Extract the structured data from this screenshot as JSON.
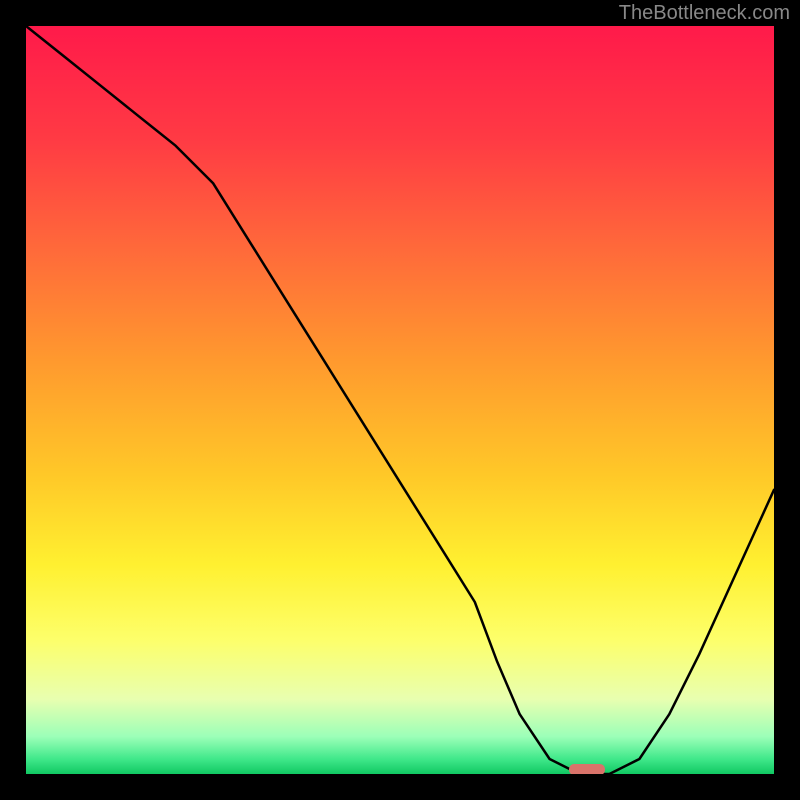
{
  "watermark": "TheBottleneck.com",
  "chart_data": {
    "type": "line",
    "title": "",
    "xlabel": "",
    "ylabel": "",
    "xlim": [
      0,
      100
    ],
    "ylim": [
      0,
      100
    ],
    "x": [
      0,
      5,
      10,
      15,
      20,
      25,
      30,
      35,
      40,
      45,
      50,
      55,
      60,
      63,
      66,
      70,
      74,
      78,
      82,
      86,
      90,
      95,
      100
    ],
    "values": [
      100,
      96,
      92,
      88,
      84,
      79,
      71,
      63,
      55,
      47,
      39,
      31,
      23,
      15,
      8,
      2,
      0,
      0,
      2,
      8,
      16,
      27,
      38
    ],
    "marker": {
      "x": 75,
      "y": 0,
      "color": "#d9736a"
    },
    "gradient_stops": [
      {
        "offset": 0.0,
        "color": "#ff1a4a"
      },
      {
        "offset": 0.15,
        "color": "#ff3a44"
      },
      {
        "offset": 0.3,
        "color": "#ff6a3a"
      },
      {
        "offset": 0.45,
        "color": "#ff9a2e"
      },
      {
        "offset": 0.6,
        "color": "#ffc828"
      },
      {
        "offset": 0.72,
        "color": "#fff030"
      },
      {
        "offset": 0.82,
        "color": "#fdff6a"
      },
      {
        "offset": 0.9,
        "color": "#e8ffb0"
      },
      {
        "offset": 0.95,
        "color": "#9cffb8"
      },
      {
        "offset": 0.98,
        "color": "#40e88a"
      },
      {
        "offset": 1.0,
        "color": "#10c862"
      }
    ]
  }
}
